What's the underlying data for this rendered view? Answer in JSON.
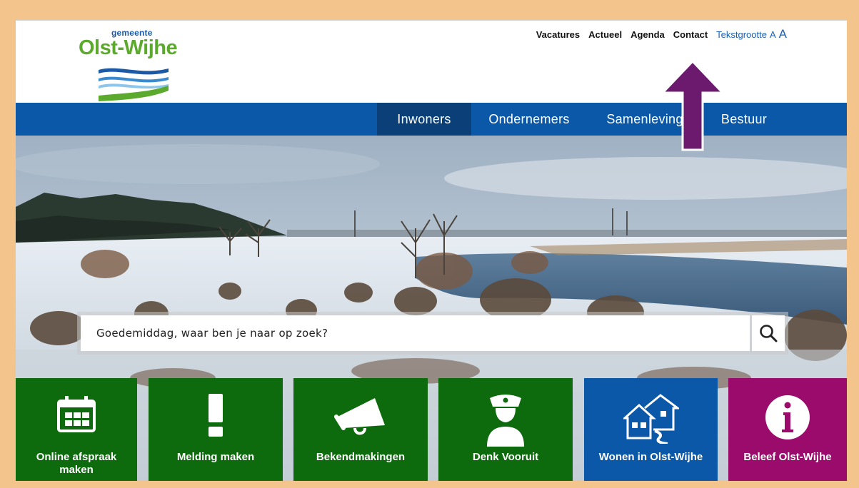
{
  "header": {
    "logo_small": "gemeente",
    "logo_main": "Olst-Wijhe",
    "links": [
      "Vacatures",
      "Actueel",
      "Agenda",
      "Contact"
    ],
    "text_size_label": "Tekstgrootte",
    "text_size_small": "A",
    "text_size_large": "A"
  },
  "nav": {
    "items": [
      "Inwoners",
      "Ondernemers",
      "Samenleving",
      "Bestuur"
    ]
  },
  "search": {
    "placeholder": "Goedemiddag, waar ben je naar op zoek?"
  },
  "tiles": [
    {
      "label": "Online afspraak maken",
      "icon": "calendar-icon",
      "color": "#0d6b0d"
    },
    {
      "label": "Melding maken",
      "icon": "exclamation-icon",
      "color": "#0d6b0d"
    },
    {
      "label": "Bekendmakingen",
      "icon": "megaphone-icon",
      "color": "#0d6b0d"
    },
    {
      "label": "Denk Vooruit",
      "icon": "police-officer-icon",
      "color": "#0d6b0d"
    },
    {
      "label": "Wonen in Olst-Wijhe",
      "icon": "houses-icon",
      "color": "#0b57a8"
    },
    {
      "label": "Beleef Olst-Wijhe",
      "icon": "info-icon",
      "color": "#9a0b6b"
    }
  ],
  "colors": {
    "nav_blue": "#0b57a8",
    "nav_active": "#0a3f78",
    "tile_green": "#0d6b0d",
    "tile_purple": "#9a0b6b",
    "annotation_arrow": "#6b1a6e",
    "page_border": "#f3c58c"
  }
}
